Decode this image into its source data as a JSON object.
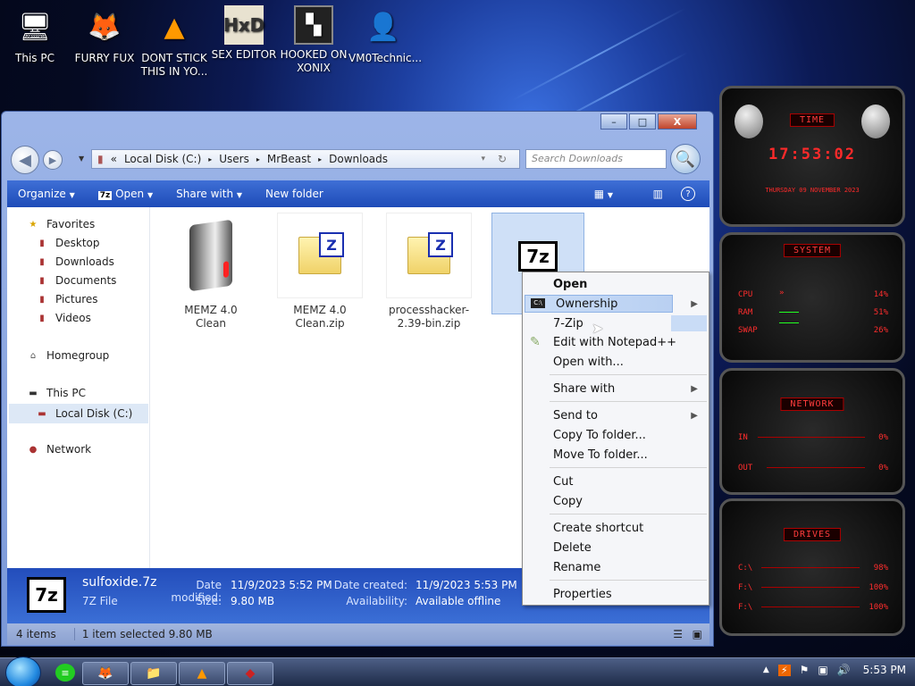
{
  "desktop": {
    "icons": [
      {
        "label": "This PC",
        "icon": "computer-icon"
      },
      {
        "label": "FURRY FUX",
        "icon": "firefox-icon"
      },
      {
        "label": "DONT STICK THIS IN YO...",
        "icon": "vlc-cone-icon"
      },
      {
        "label": "SEX EDITOR",
        "icon": "hxd-icon"
      },
      {
        "label": "HOOKED ON XONIX",
        "icon": "xonix-icon"
      },
      {
        "label": "VM0Technic...",
        "icon": "user-avatar-icon"
      }
    ]
  },
  "window": {
    "title_buttons": [
      "–",
      "□",
      "X"
    ],
    "breadcrumb": [
      "Local Disk (C:)",
      "Users",
      "MrBeast",
      "Downloads"
    ],
    "breadcrumb_prefix": "«",
    "search_placeholder": "Search Downloads",
    "commands": {
      "organize": "Organize",
      "open": "Open",
      "share_with": "Share with",
      "new_folder": "New folder"
    },
    "nav": {
      "favorites": "Favorites",
      "desktop": "Desktop",
      "downloads": "Downloads",
      "documents": "Documents",
      "pictures": "Pictures",
      "videos": "Videos",
      "homegroup": "Homegroup",
      "this_pc": "This PC",
      "local_disk": "Local Disk (C:)",
      "network": "Network"
    },
    "files": [
      {
        "name": "MEMZ 4.0 Clean",
        "type": "exe"
      },
      {
        "name": "MEMZ 4.0 Clean.zip",
        "type": "zip"
      },
      {
        "name": "processhacker-2.39-bin.zip",
        "type": "zip"
      },
      {
        "name": "sul",
        "type": "7z",
        "selected": true
      }
    ],
    "details": {
      "filename": "sulfoxide.7z",
      "filetype": "7Z File",
      "date_modified_label": "Date modified:",
      "date_modified": "11/9/2023 5:52 PM",
      "size_label": "Size:",
      "size": "9.80 MB",
      "date_created_label": "Date created:",
      "date_created": "11/9/2023 5:53 PM",
      "availability_label": "Availability:",
      "availability": "Available offline"
    },
    "status": {
      "item_count": "4 items",
      "selection": "1 item selected  9.80 MB"
    }
  },
  "context_menu": {
    "open": "Open",
    "ownership": "Ownership",
    "seven_zip": "7-Zip",
    "edit_notepad": "Edit with Notepad++",
    "open_with": "Open with...",
    "share_with": "Share with",
    "send_to": "Send to",
    "copy_to_folder": "Copy To folder...",
    "move_to_folder": "Move To folder...",
    "cut": "Cut",
    "copy": "Copy",
    "create_shortcut": "Create shortcut",
    "delete": "Delete",
    "rename": "Rename",
    "properties": "Properties"
  },
  "gadgets": {
    "time": {
      "title": "TIME",
      "clock": "17:53:02",
      "date": "THURSDAY 09 NOVEMBER 2023"
    },
    "system": {
      "title": "SYSTEM",
      "rows": [
        {
          "label": "CPU",
          "value": "14%"
        },
        {
          "label": "RAM",
          "value": "51%"
        },
        {
          "label": "SWAP",
          "value": "26%"
        }
      ]
    },
    "network": {
      "title": "NETWORK",
      "rows": [
        {
          "label": "IN",
          "value": "0%"
        },
        {
          "label": "OUT",
          "value": "0%"
        }
      ]
    },
    "drives": {
      "title": "DRIVES",
      "rows": [
        {
          "label": "C:\\",
          "value": "98%"
        },
        {
          "label": "F:\\",
          "value": "100%"
        },
        {
          "label": "F:\\",
          "value": "100%"
        }
      ]
    }
  },
  "taskbar": {
    "clock": "5:53 PM",
    "pinned": [
      "firefox-icon",
      "explorer-icon",
      "vlc-cone-icon",
      "memz-icon"
    ]
  },
  "colors": {
    "accent": "#2a55c0",
    "gadget_red": "#ff2a2a",
    "selection": "#cfe0f7"
  }
}
